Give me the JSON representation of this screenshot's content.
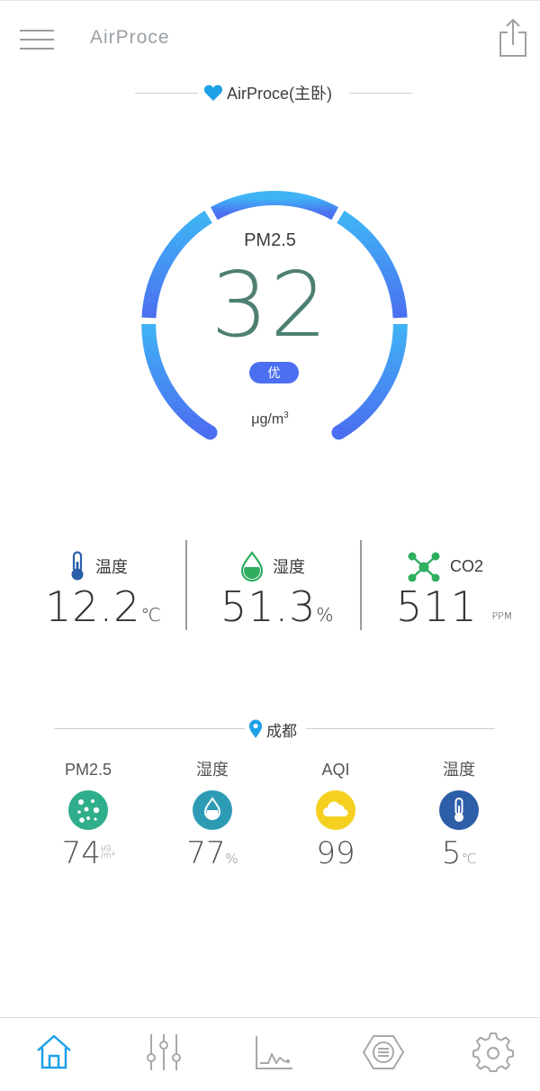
{
  "header": {
    "app_title": "AirProce",
    "menu_icon": "hamburger-menu-icon",
    "share_icon": "share-icon"
  },
  "device": {
    "name": "AirProce(主卧)",
    "icon": "heart-icon",
    "accent": "#1ea0e6"
  },
  "pm25": {
    "label": "PM2.5",
    "value": "32",
    "quality": "优",
    "unit_base": "μg/m",
    "unit_sup": "3",
    "gauge_fraction": 1.0
  },
  "indoor": [
    {
      "label": "温度",
      "value": "12.2",
      "unit": "℃",
      "icon": "thermometer-icon"
    },
    {
      "label": "湿度",
      "value": "51.3",
      "unit": "%",
      "icon": "water-drop-icon"
    },
    {
      "label": "CO2",
      "value": "511",
      "unit": "PPM",
      "icon": "molecule-icon"
    }
  ],
  "city": {
    "name": "成都",
    "icon": "location-pin-icon",
    "items": [
      {
        "label": "PM2.5",
        "value": "74",
        "unit_top": "μg",
        "unit_bottom": "/m³",
        "icon": "particles-icon",
        "color": "#2fae8b"
      },
      {
        "label": "湿度",
        "value": "77",
        "unit": "%",
        "icon": "droplet-icon",
        "color": "#2e9bb5"
      },
      {
        "label": "AQI",
        "value": "99",
        "unit": "",
        "icon": "cloud-icon",
        "color": "#f5d020"
      },
      {
        "label": "温度",
        "value": "5",
        "unit": "℃",
        "icon": "thermometer-icon",
        "color": "#2d5ea8"
      }
    ]
  },
  "nav": [
    {
      "icon": "home-icon",
      "active": true
    },
    {
      "icon": "sliders-icon",
      "active": false
    },
    {
      "icon": "chart-icon",
      "active": false
    },
    {
      "icon": "filter-icon",
      "active": false
    },
    {
      "icon": "gear-icon",
      "active": false
    }
  ],
  "colors": {
    "gauge_start": "#4b6ff0",
    "gauge_end": "#3fb4f5",
    "value_green": "#4e7f73",
    "active_nav": "#1ea0e6"
  }
}
